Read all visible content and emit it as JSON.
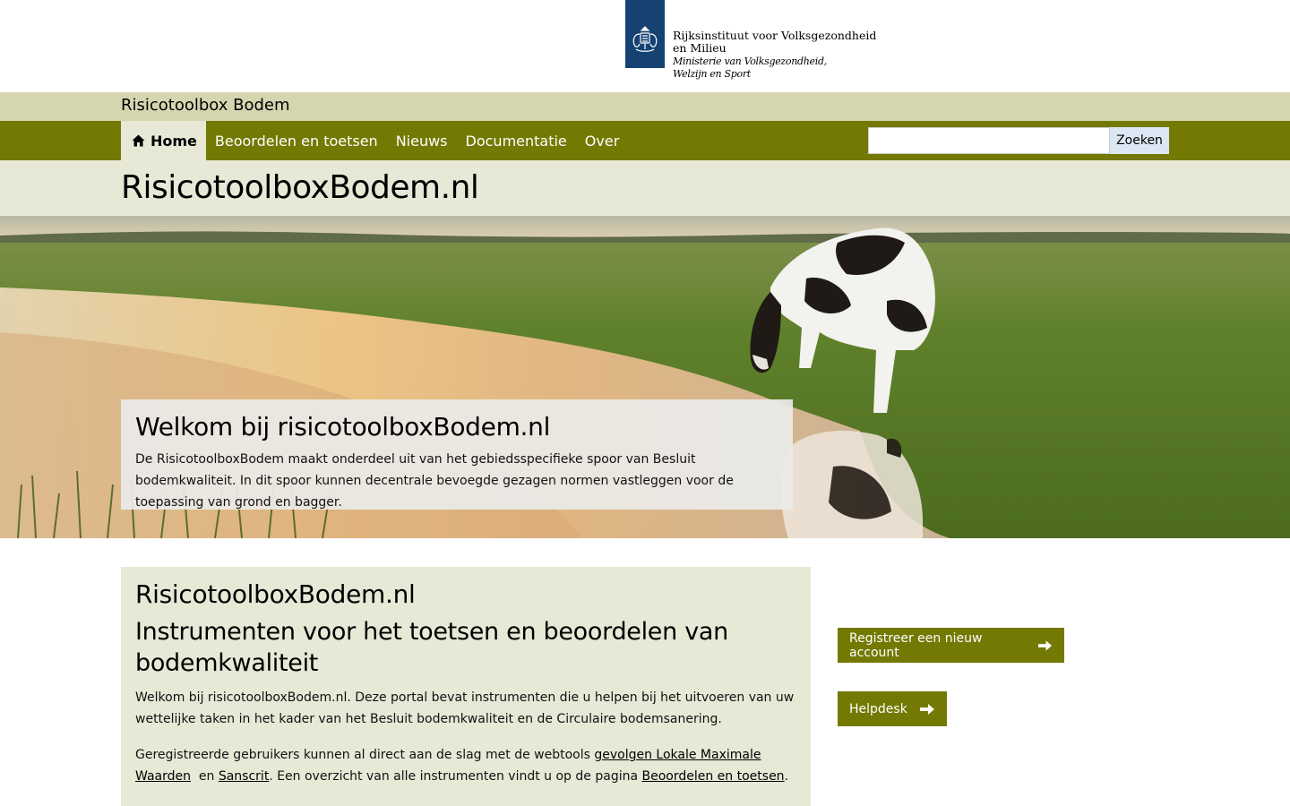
{
  "header": {
    "org_name_line1": "Rijksinstituut voor Volksgezondheid",
    "org_name_line2": "en Milieu",
    "ministry_line1": "Ministerie van Volksgezondheid,",
    "ministry_line2": "Welzijn en Sport",
    "logo_icon": "coat-of-arms-icon"
  },
  "site": {
    "name": "Risicotoolbox Bodem"
  },
  "nav": {
    "items": [
      {
        "label": "Home",
        "icon": "home-icon",
        "active": true
      },
      {
        "label": "Beoordelen en toetsen"
      },
      {
        "label": "Nieuws"
      },
      {
        "label": "Documentatie"
      },
      {
        "label": "Over"
      }
    ]
  },
  "search": {
    "value": "",
    "placeholder": "",
    "button_label": "Zoeken"
  },
  "page": {
    "title": "RisicotoolboxBodem.nl"
  },
  "hero": {
    "title": "Welkom bij risicotoolboxBodem.nl",
    "text": "De RisicotoolboxBodem maakt onderdeel uit van het gebiedsspecifieke spoor van Besluit bodemkwaliteit. In dit spoor kunnen decentrale bevoegde gezagen normen vastleggen voor de toepassing van grond en bagger."
  },
  "main": {
    "heading": "RisicotoolboxBodem.nl",
    "subheading": "Instrumenten voor het toetsen en beoordelen van bodemkwaliteit",
    "paragraph1": "Welkom bij risicotoolboxBodem.nl. Deze portal bevat instrumenten die u helpen bij het uitvoeren van uw wettelijke taken in het kader van het Besluit bodemkwaliteit en de Circulaire bodemsanering.",
    "paragraph2_part1": "Geregistreerde gebruikers kunnen al direct aan de slag met de webtools ",
    "link1": "gevolgen Lokale Maximale Waarden",
    "paragraph2_part2": "  en ",
    "link2": "Sanscrit",
    "paragraph2_part3": ". Een overzicht van alle instrumenten vindt u op de pagina ",
    "link3": "Beoordelen en toetsen",
    "paragraph2_part4": "."
  },
  "sidebar": {
    "register_label": "Registreer een nieuw account",
    "helpdesk_label": "Helpdesk",
    "arrow_icon": "arrow-right-icon"
  },
  "colors": {
    "nav_green": "#737902",
    "site_bar": "#d5d6b0",
    "light_band": "#e7e8d6",
    "logo_blue": "#154273"
  }
}
